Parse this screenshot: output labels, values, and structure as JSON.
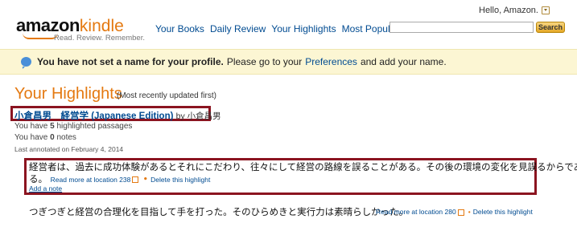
{
  "header": {
    "greeting": "Hello, Amazon.",
    "logo_brand": "amazon",
    "logo_product": "kindle",
    "logo_tagline": "Read. Review. Remember."
  },
  "nav": {
    "items": [
      "Your Books",
      "Daily Review",
      "Your Highlights",
      "Most Popular"
    ]
  },
  "search": {
    "button": "Search",
    "placeholder": ""
  },
  "notice": {
    "bold": "You have not set a name for your profile.",
    "pre": "Please go to your",
    "link": "Preferences",
    "post": "and add your name."
  },
  "main": {
    "title": "Your Highlights",
    "subtitle": "(Most recently updated first)",
    "book": {
      "title": "小倉昌男　経営学 (Japanese Edition)",
      "by": "by 小倉昌男",
      "highlights_pre": "You have",
      "highlights_count": "5",
      "highlights_post": "highlighted passages",
      "notes_pre": "You have",
      "notes_count": "0",
      "notes_post": "notes",
      "last_annotated": "Last annotated on February 4, 2014"
    },
    "highlights": [
      {
        "line1": "経営者は、過去に成功体験があるとそれにこだわり、往々にして経営の路線を誤ることがある。その後の環境の変化を見誤るからであ",
        "line2": "る。",
        "read_more": "Read more at location 238",
        "delete": "Delete this highlight",
        "add_note": "Add a note"
      },
      {
        "line1": "つぎつぎと経営の合理化を目指して手を打った。そのひらめきと実行力は素晴らしかった。",
        "read_more": "Read more at location 280",
        "delete": "Delete this highlight"
      }
    ]
  }
}
